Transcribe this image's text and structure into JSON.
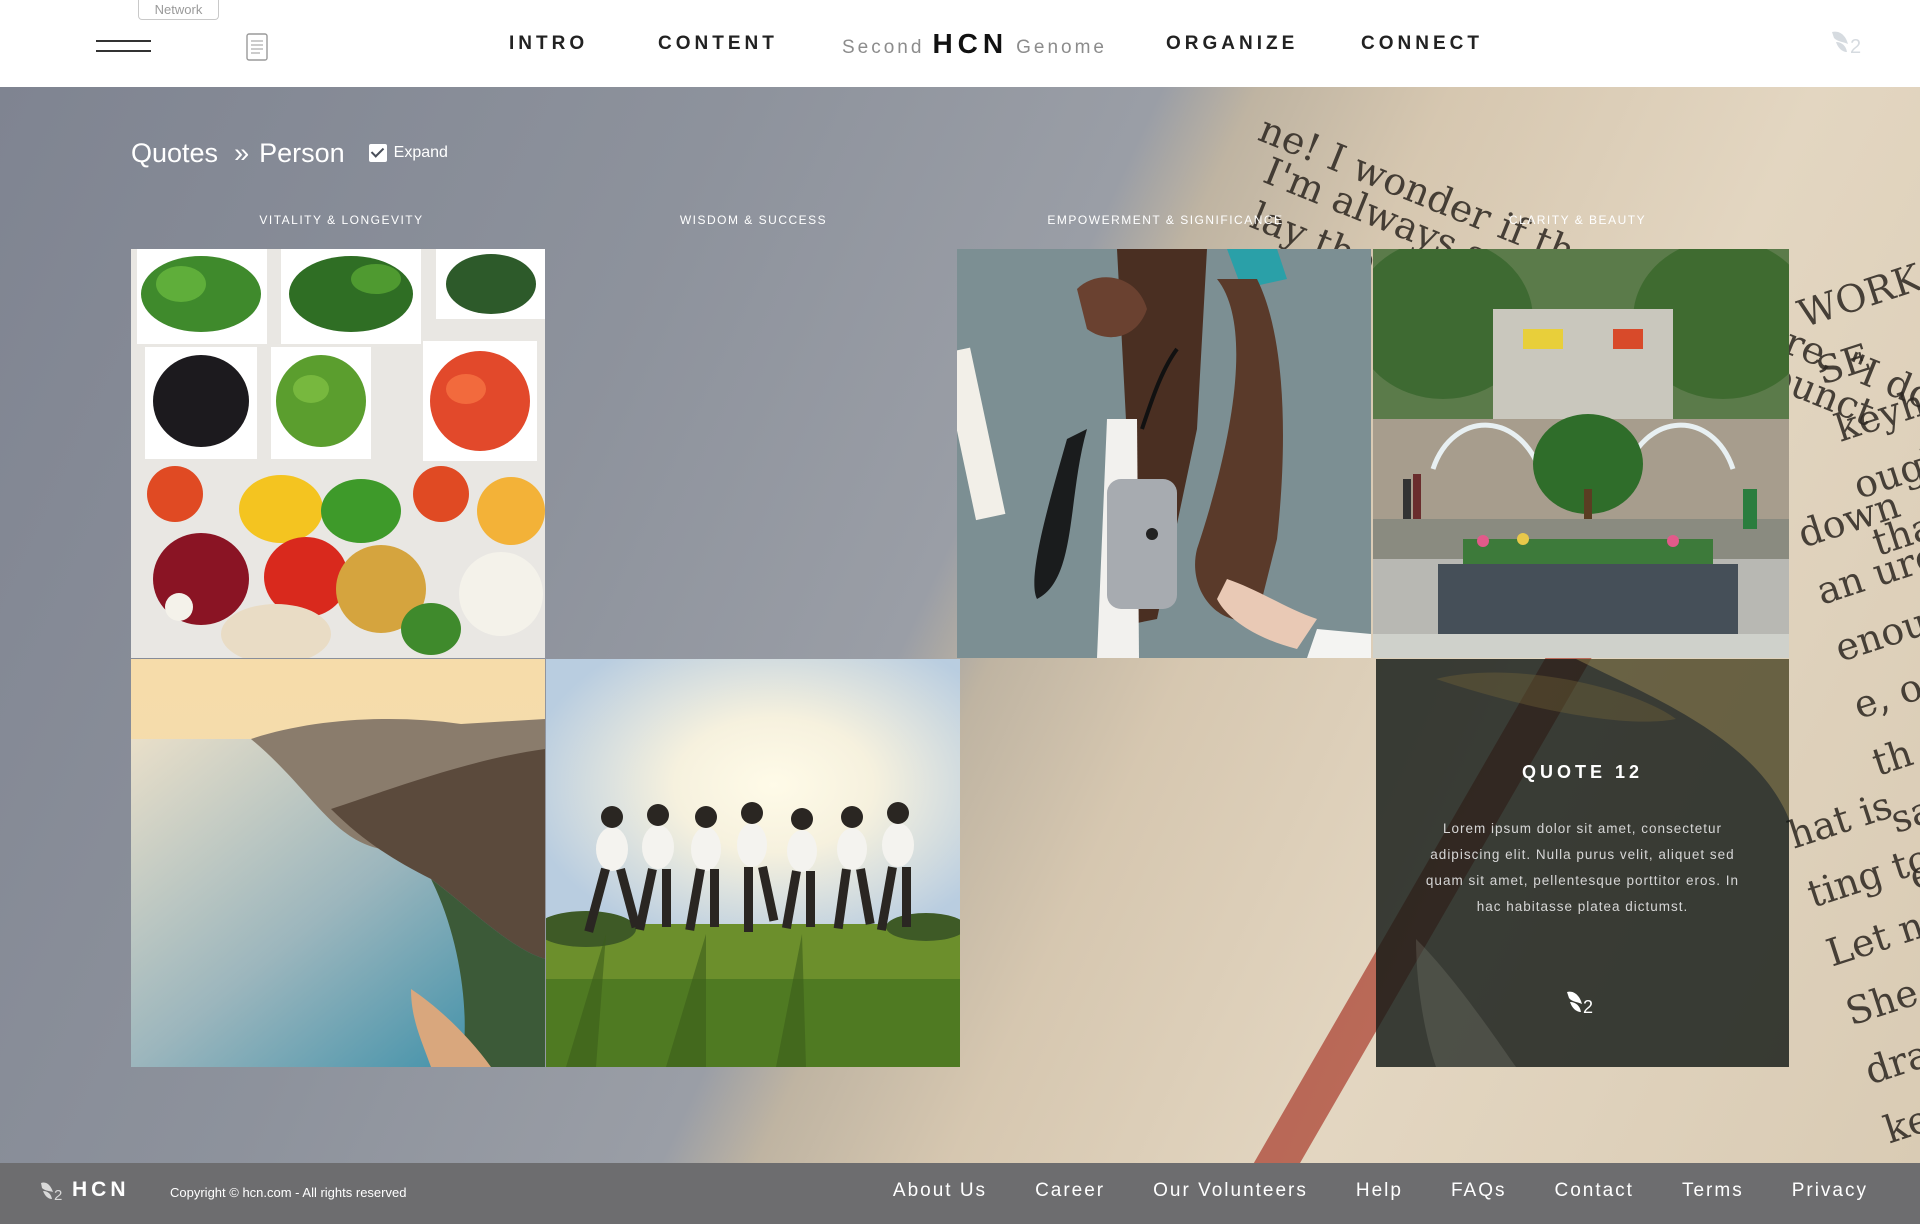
{
  "header": {
    "network_tab": "Network",
    "nav_left": [
      "INTRO",
      "CONTENT"
    ],
    "brand": {
      "prefix": "Second",
      "name": "HCN",
      "suffix": "Genome"
    },
    "nav_right": [
      "ORGANIZE",
      "CONNECT"
    ]
  },
  "breadcrumb": {
    "items": [
      "Quotes",
      "Person"
    ],
    "separator": "»",
    "expand_label": "Expand",
    "expand_checked": true
  },
  "categories": [
    "VITALITY & LONGEVITY",
    "WISDOM & SUCCESS",
    "EMPOWERMENT & SIGNIFICANCE",
    "CLARITY & BEAUTY"
  ],
  "quote_card": {
    "title": "QUOTE 12",
    "body": "Lorem ipsum dolor sit amet, consectetur adipiscing elit. Nulla purus velit, aliquet sed quam sit amet, pellentesque porttitor eros. In hac habitasse platea dictumst."
  },
  "background_text": [
    "ne! I wonder if they'd any more, \"I don't.\" A few",
    "I'm always so late, try to be punct",
    "lay the table.\" She dried her",
    "WORK SE keyhole- ough tha",
    "down an ure enou e, of th e saw fi et out his eyes",
    "hat is ting to Let n She drag keyhole- the ama"
  ],
  "footer": {
    "brand": "HCN",
    "copyright": "Copyright © hcn.com - All rights reserved",
    "links": [
      "About Us",
      "Career",
      "Our Volunteers",
      "Help",
      "FAQs",
      "Contact",
      "Terms",
      "Privacy"
    ]
  },
  "colors": {
    "header_bg": "#ffffff",
    "footer_bg": "#6d6d6f",
    "quote_card_bg": "#141a16",
    "accent_red": "#a83a2b"
  }
}
